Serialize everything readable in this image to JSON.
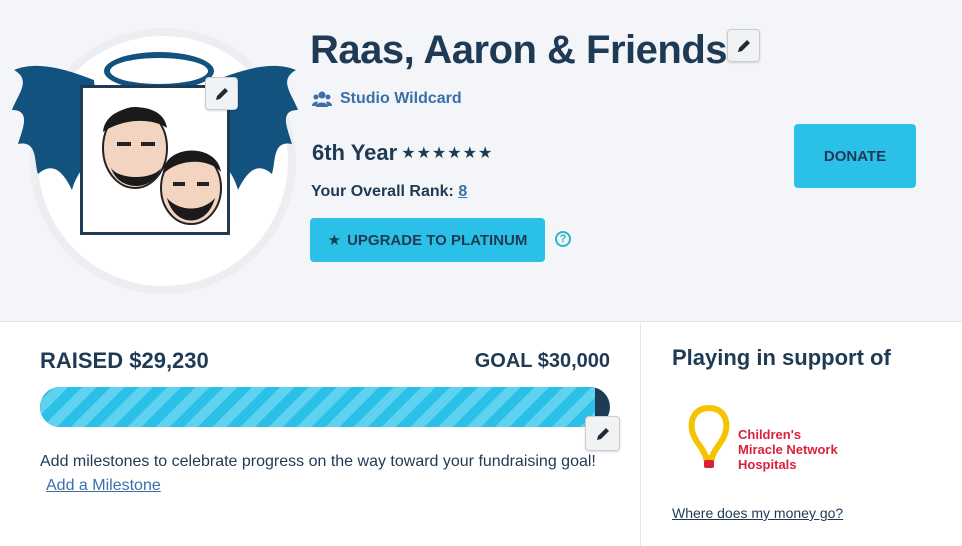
{
  "profile": {
    "name": "Raas, Aaron & Friends",
    "studio": "Studio Wildcard",
    "year": "6th Year",
    "stars": "★★★★★★",
    "rank_label": "Your Overall Rank:",
    "rank_value": "8",
    "upgrade_label": "UPGRADE TO PLATINUM",
    "donate_label": "DONATE"
  },
  "fundraising": {
    "raised": "RAISED $29,230",
    "goal": "GOAL $30,000",
    "progress_fraction": 0.974,
    "milestone_text": "Add milestones to celebrate progress on the way toward your fundraising goal!",
    "milestone_link": "Add a Milestone"
  },
  "support": {
    "title": "Playing in support of",
    "org_line1": "Children's",
    "org_line2": "Miracle Network",
    "org_line3": "Hospitals",
    "money_link": "Where does my money go?"
  },
  "colors": {
    "navy": "#1e3a55",
    "accent": "#2bc0e8",
    "link": "#3a6fa8",
    "cmn_red": "#d6233b",
    "cmn_yellow": "#f5c400"
  }
}
